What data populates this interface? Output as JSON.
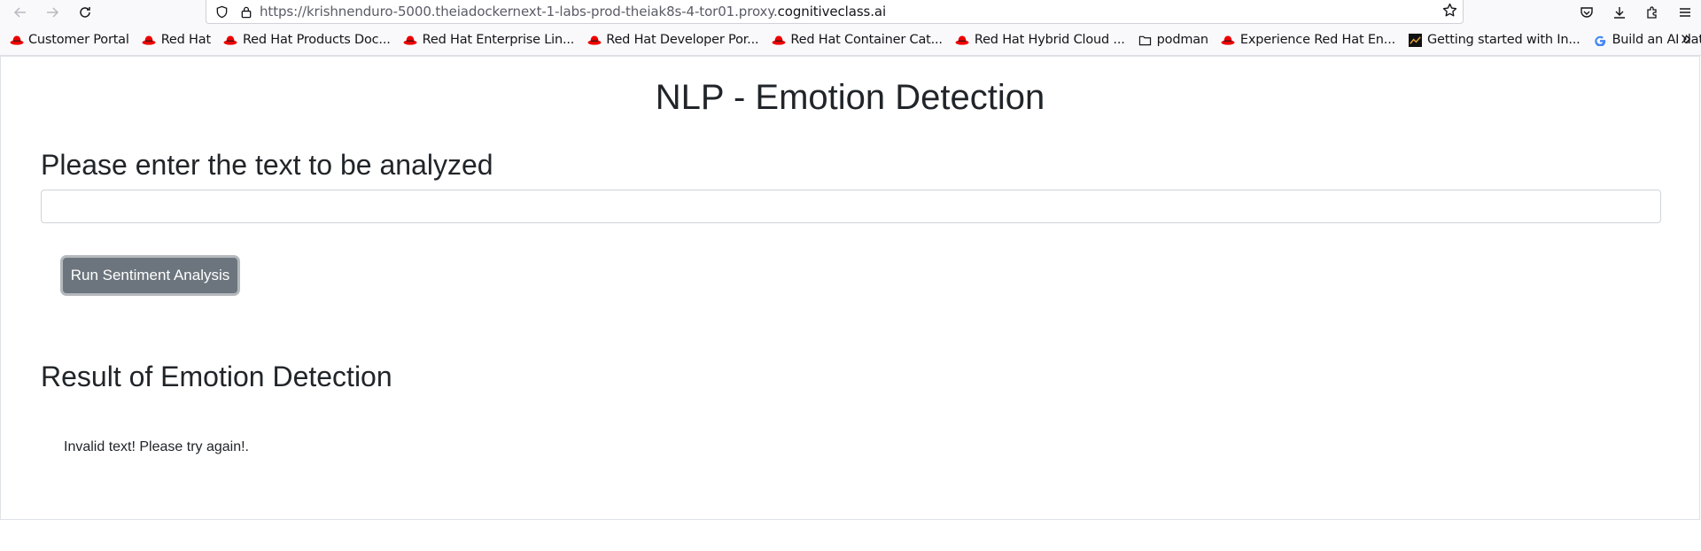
{
  "browser": {
    "url_path": "https://krishnenduro-5000.theiadockernext-1-labs-prod-theiak8s-4-tor01.proxy.",
    "url_host": "cognitiveclass.ai",
    "bookmarks": [
      {
        "label": "Customer Portal",
        "icon": "redhat-icon"
      },
      {
        "label": "Red Hat",
        "icon": "redhat-icon"
      },
      {
        "label": "Red Hat Products Doc...",
        "icon": "redhat-icon"
      },
      {
        "label": "Red Hat Enterprise Lin...",
        "icon": "redhat-icon"
      },
      {
        "label": "Red Hat Developer Por...",
        "icon": "redhat-icon"
      },
      {
        "label": "Red Hat Container Cat...",
        "icon": "redhat-icon"
      },
      {
        "label": "Red Hat Hybrid Cloud ...",
        "icon": "redhat-icon"
      },
      {
        "label": "podman",
        "icon": "folder-icon"
      },
      {
        "label": "Experience Red Hat En...",
        "icon": "redhat-icon"
      },
      {
        "label": "Getting started with In...",
        "icon": "chart-icon"
      },
      {
        "label": "Build an AI data explor...",
        "icon": "google-icon"
      }
    ],
    "colors": {
      "redhat": "#ee0000",
      "chrome_bg": "#f9f9fb"
    }
  },
  "page": {
    "title": "NLP - Emotion Detection",
    "input_heading": "Please enter the text to be analyzed",
    "input_value": "",
    "run_button_label": "Run Sentiment Analysis",
    "result_heading": "Result of Emotion Detection",
    "result_text": "Invalid text! Please try again!.",
    "colors": {
      "button_bg": "#6c757d",
      "text": "#212529"
    }
  }
}
